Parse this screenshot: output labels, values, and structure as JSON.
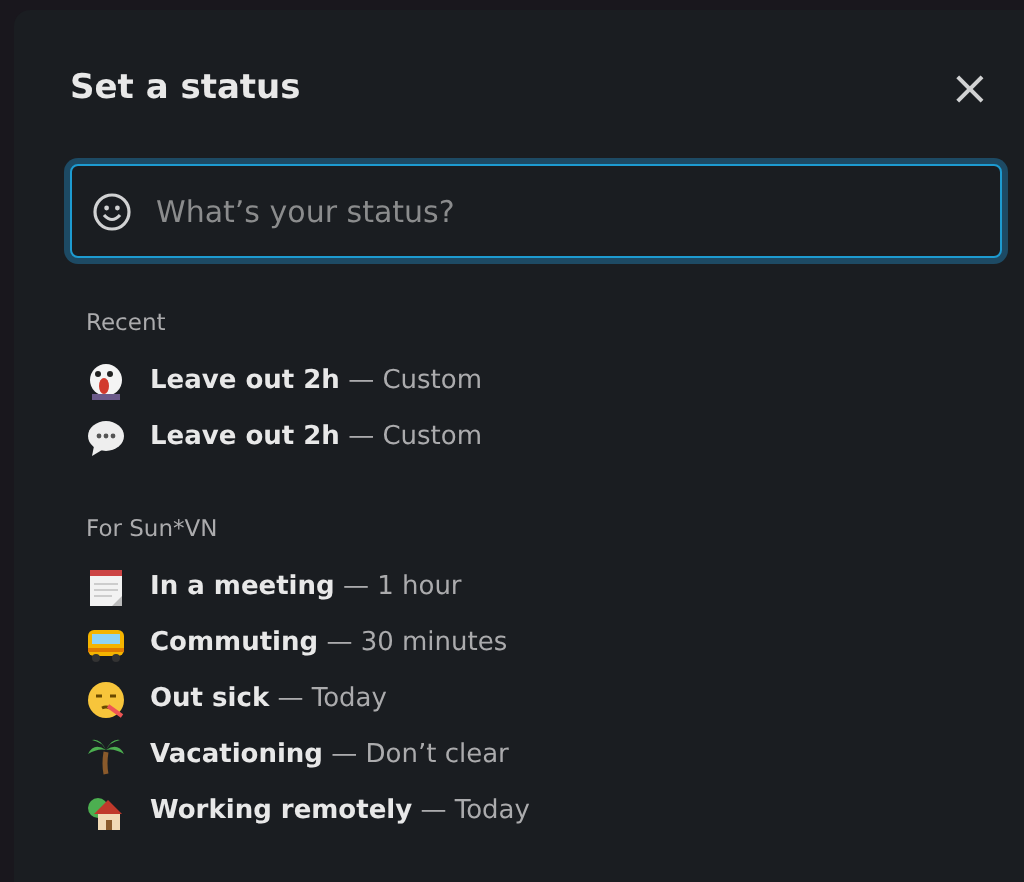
{
  "dialog": {
    "title": "Set a status",
    "close": "×"
  },
  "search": {
    "placeholder": "What’s your status?"
  },
  "sections": [
    {
      "heading": "Recent",
      "items": [
        {
          "kind": "scream",
          "label": "Leave out 2h",
          "detail": "— Custom"
        },
        {
          "kind": "speech",
          "label": "Leave out 2h",
          "detail": "— Custom"
        }
      ]
    },
    {
      "heading": "For Sun*VN",
      "items": [
        {
          "kind": "calendar",
          "label": "In a meeting",
          "detail": "— 1 hour"
        },
        {
          "kind": "bus",
          "label": "Commuting",
          "detail": "— 30 minutes"
        },
        {
          "kind": "sick",
          "label": "Out sick",
          "detail": "— Today"
        },
        {
          "kind": "palm",
          "label": "Vacationing",
          "detail": "— Don’t clear"
        },
        {
          "kind": "house",
          "label": "Working remotely",
          "detail": "— Today"
        }
      ]
    }
  ]
}
